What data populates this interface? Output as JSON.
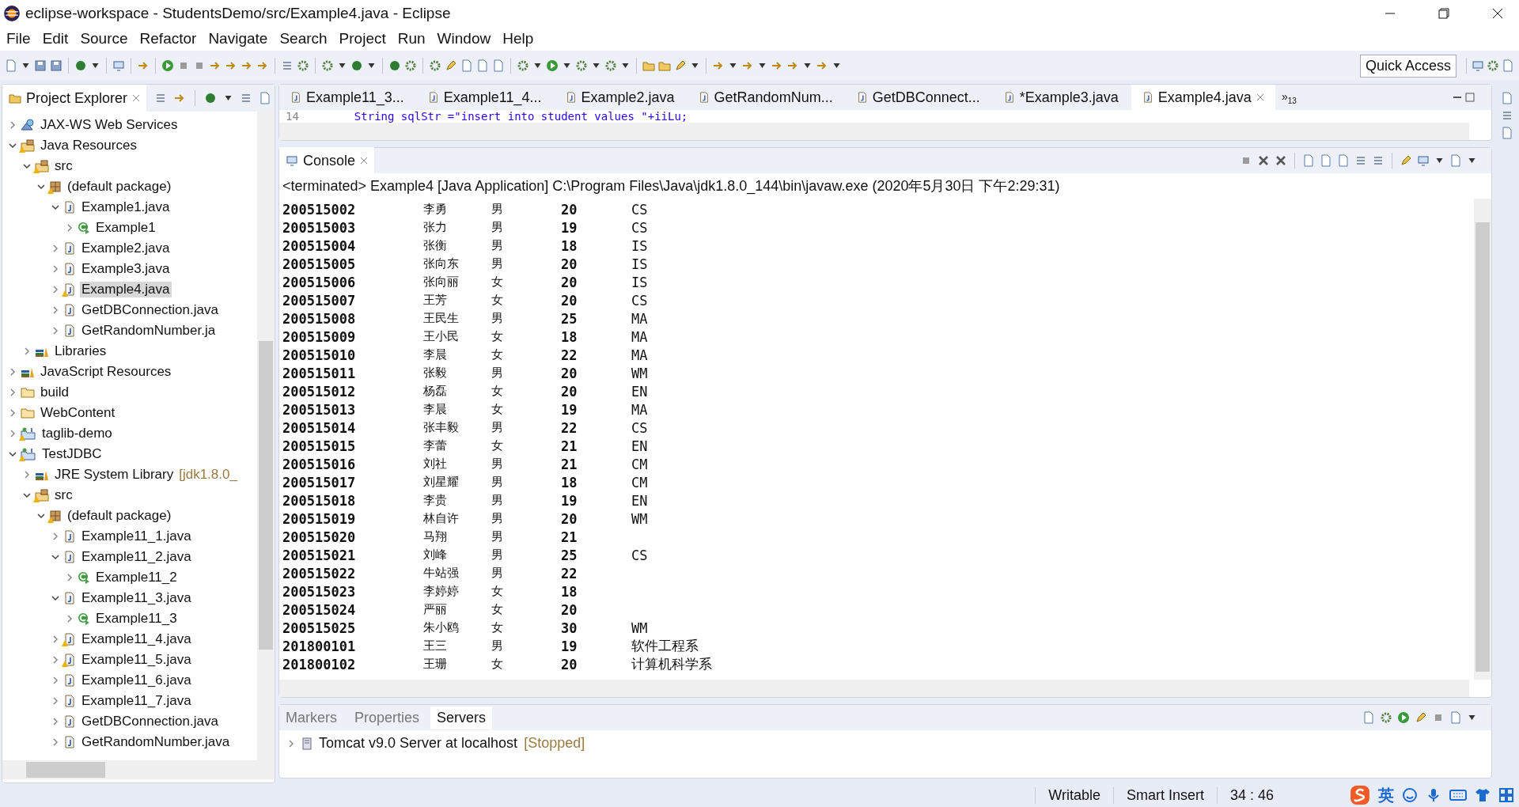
{
  "window": {
    "title": "eclipse-workspace - StudentsDemo/src/Example4.java - Eclipse"
  },
  "menu": [
    "File",
    "Edit",
    "Source",
    "Refactor",
    "Navigate",
    "Search",
    "Project",
    "Run",
    "Window",
    "Help"
  ],
  "toolbar": {
    "quick_access": "Quick Access"
  },
  "project_explorer": {
    "title": "Project Explorer",
    "items": [
      {
        "label": "JAX-WS Web Services",
        "kind": "web-services",
        "expanded": false,
        "selected": false,
        "warning": false
      },
      {
        "label": "Java Resources",
        "kind": "source-folder",
        "expanded": true,
        "selected": false,
        "warning": true,
        "children": [
          {
            "label": "src",
            "kind": "source-folder",
            "expanded": true,
            "selected": false,
            "warning": true,
            "children": [
              {
                "label": "(default package)",
                "kind": "package",
                "expanded": true,
                "selected": false,
                "warning": true,
                "children": [
                  {
                    "label": "Example1.java",
                    "kind": "java-file",
                    "expanded": true,
                    "selected": false,
                    "warning": false,
                    "children": [
                      {
                        "label": "Example1",
                        "kind": "class",
                        "expanded": false,
                        "selected": false,
                        "warning": false
                      }
                    ]
                  },
                  {
                    "label": "Example2.java",
                    "kind": "java-file",
                    "expanded": false,
                    "selected": false,
                    "warning": false
                  },
                  {
                    "label": "Example3.java",
                    "kind": "java-file",
                    "expanded": false,
                    "selected": false,
                    "warning": false
                  },
                  {
                    "label": "Example4.java",
                    "kind": "java-file",
                    "expanded": false,
                    "selected": true,
                    "warning": true
                  },
                  {
                    "label": "GetDBConnection.java",
                    "kind": "java-file",
                    "expanded": false,
                    "selected": false,
                    "warning": false
                  },
                  {
                    "label": "GetRandomNumber.ja",
                    "kind": "java-file",
                    "expanded": false,
                    "selected": false,
                    "warning": false
                  }
                ]
              }
            ]
          },
          {
            "label": "Libraries",
            "kind": "library",
            "expanded": false,
            "selected": false,
            "warning": false
          }
        ]
      },
      {
        "label": "JavaScript Resources",
        "kind": "library",
        "expanded": false,
        "selected": false,
        "warning": false
      },
      {
        "label": "build",
        "kind": "folder",
        "expanded": false,
        "selected": false,
        "warning": false
      },
      {
        "label": "WebContent",
        "kind": "folder",
        "expanded": false,
        "selected": false,
        "warning": false
      },
      {
        "label": "taglib-demo",
        "kind": "project",
        "expanded": false,
        "selected": false,
        "warning": true
      },
      {
        "label": "TestJDBC",
        "kind": "project",
        "expanded": true,
        "selected": false,
        "warning": true,
        "children": [
          {
            "label": "JRE System Library",
            "decoration": "[jdk1.8.0_",
            "kind": "library",
            "expanded": false,
            "selected": false,
            "warning": false
          },
          {
            "label": "src",
            "kind": "source-folder",
            "expanded": true,
            "selected": false,
            "warning": true,
            "children": [
              {
                "label": "(default package)",
                "kind": "package",
                "expanded": true,
                "selected": false,
                "warning": true,
                "children": [
                  {
                    "label": "Example11_1.java",
                    "kind": "java-file",
                    "expanded": false,
                    "selected": false,
                    "warning": false
                  },
                  {
                    "label": "Example11_2.java",
                    "kind": "java-file",
                    "expanded": true,
                    "selected": false,
                    "warning": false,
                    "children": [
                      {
                        "label": "Example11_2",
                        "kind": "class",
                        "expanded": false,
                        "selected": false,
                        "warning": false
                      }
                    ]
                  },
                  {
                    "label": "Example11_3.java",
                    "kind": "java-file",
                    "expanded": true,
                    "selected": false,
                    "warning": false,
                    "children": [
                      {
                        "label": "Example11_3",
                        "kind": "class",
                        "expanded": false,
                        "selected": false,
                        "warning": false
                      }
                    ]
                  },
                  {
                    "label": "Example11_4.java",
                    "kind": "java-file",
                    "expanded": false,
                    "selected": false,
                    "warning": true
                  },
                  {
                    "label": "Example11_5.java",
                    "kind": "java-file",
                    "expanded": false,
                    "selected": false,
                    "warning": true
                  },
                  {
                    "label": "Example11_6.java",
                    "kind": "java-file",
                    "expanded": false,
                    "selected": false,
                    "warning": false
                  },
                  {
                    "label": "Example11_7.java",
                    "kind": "java-file",
                    "expanded": false,
                    "selected": false,
                    "warning": false
                  },
                  {
                    "label": "GetDBConnection.java",
                    "kind": "java-file",
                    "expanded": false,
                    "selected": false,
                    "warning": false
                  },
                  {
                    "label": "GetRandomNumber.java",
                    "kind": "java-file",
                    "expanded": false,
                    "selected": false,
                    "warning": false
                  }
                ]
              }
            ]
          }
        ]
      }
    ]
  },
  "editor": {
    "tabs": [
      {
        "label": "Example11_3...",
        "selected": false
      },
      {
        "label": "Example11_4...",
        "selected": false
      },
      {
        "label": "Example2.java",
        "selected": false
      },
      {
        "label": "GetRandomNum...",
        "selected": false
      },
      {
        "label": "GetDBConnect...",
        "selected": false
      },
      {
        "label": "*Example3.java",
        "selected": false
      },
      {
        "label": "Example4.java",
        "selected": true
      }
    ],
    "overflow_chevron": "»",
    "overflow_count": "13",
    "line_number": "14",
    "code": "String sqlStr =\"insert into student values \"+iiLu;"
  },
  "console": {
    "title": "Console",
    "status": "<terminated> Example4 [Java Application] C:\\Program Files\\Java\\jdk1.8.0_144\\bin\\javaw.exe (2020年5月30日 下午2:29:31)",
    "rows": [
      {
        "id": "200515002",
        "name": "李勇",
        "gender": "男",
        "age": "20",
        "dept": "CS"
      },
      {
        "id": "200515003",
        "name": "张力",
        "gender": "男",
        "age": "19",
        "dept": "CS"
      },
      {
        "id": "200515004",
        "name": "张衡",
        "gender": "男",
        "age": "18",
        "dept": "IS"
      },
      {
        "id": "200515005",
        "name": "张向东",
        "gender": "男",
        "age": "20",
        "dept": "IS"
      },
      {
        "id": "200515006",
        "name": "张向丽",
        "gender": "女",
        "age": "20",
        "dept": "IS"
      },
      {
        "id": "200515007",
        "name": "王芳",
        "gender": "女",
        "age": "20",
        "dept": "CS"
      },
      {
        "id": "200515008",
        "name": "王民生",
        "gender": "男",
        "age": "25",
        "dept": "MA"
      },
      {
        "id": "200515009",
        "name": "王小民",
        "gender": "女",
        "age": "18",
        "dept": "MA"
      },
      {
        "id": "200515010",
        "name": "李晨",
        "gender": "女",
        "age": "22",
        "dept": "MA"
      },
      {
        "id": "200515011",
        "name": "张毅",
        "gender": "男",
        "age": "20",
        "dept": "WM"
      },
      {
        "id": "200515012",
        "name": "杨磊",
        "gender": "女",
        "age": "20",
        "dept": "EN"
      },
      {
        "id": "200515013",
        "name": "李晨",
        "gender": "女",
        "age": "19",
        "dept": "MA"
      },
      {
        "id": "200515014",
        "name": "张丰毅",
        "gender": "男",
        "age": "22",
        "dept": "CS"
      },
      {
        "id": "200515015",
        "name": "李蕾",
        "gender": "女",
        "age": "21",
        "dept": "EN"
      },
      {
        "id": "200515016",
        "name": "刘社",
        "gender": "男",
        "age": "21",
        "dept": "CM"
      },
      {
        "id": "200515017",
        "name": "刘星耀",
        "gender": "男",
        "age": "18",
        "dept": "CM"
      },
      {
        "id": "200515018",
        "name": "李贵",
        "gender": "男",
        "age": "19",
        "dept": "EN"
      },
      {
        "id": "200515019",
        "name": "林自许",
        "gender": "男",
        "age": "20",
        "dept": "WM"
      },
      {
        "id": "200515020",
        "name": "马翔",
        "gender": "男",
        "age": "21"
      },
      {
        "id": "200515021",
        "name": "刘峰",
        "gender": "男",
        "age": "25",
        "dept": "CS"
      },
      {
        "id": "200515022",
        "name": "牛站强",
        "gender": "男",
        "age": "22"
      },
      {
        "id": "200515023",
        "name": "李婷婷",
        "gender": "女",
        "age": "18"
      },
      {
        "id": "200515024",
        "name": "严丽",
        "gender": "女",
        "age": "20"
      },
      {
        "id": "200515025",
        "name": "朱小鸥",
        "gender": "女",
        "age": "30",
        "dept": "WM"
      },
      {
        "id": "201800101",
        "name": "王三",
        "gender": "男",
        "age": "19",
        "dept": "软件工程系"
      },
      {
        "id": "201800102",
        "name": "王珊",
        "gender": "女",
        "age": "20",
        "dept": "计算机科学系"
      }
    ]
  },
  "bottom_panel": {
    "tabs": [
      {
        "label": "Markers",
        "selected": false
      },
      {
        "label": "Properties",
        "selected": false
      },
      {
        "label": "Servers",
        "selected": true
      }
    ],
    "servers": [
      {
        "name": "Tomcat v9.0 Server at localhost",
        "state": "[Stopped]"
      }
    ]
  },
  "status_bar": {
    "mode": "Writable",
    "insert": "Smart Insert",
    "position": "34 : 46",
    "ime": "英"
  }
}
